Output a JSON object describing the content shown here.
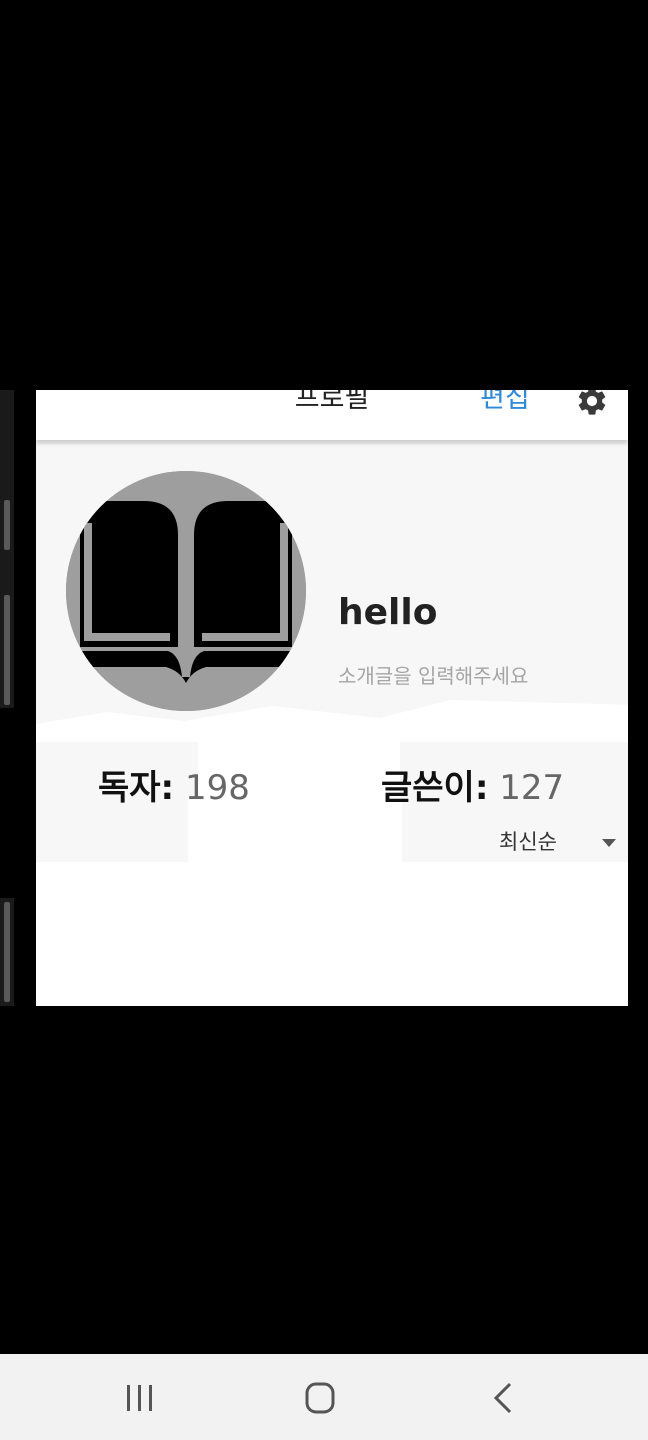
{
  "appbar": {
    "title": "프로필",
    "edit_label": "편집",
    "settings_icon": "gear-icon"
  },
  "profile": {
    "avatar_icon": "open-book-icon",
    "username": "hello",
    "bio_placeholder": "소개글을 입력해주세요"
  },
  "stats": {
    "readers_label": "독자:",
    "readers_value": "198",
    "writers_label": "글쓴이:",
    "writers_value": "127"
  },
  "sort": {
    "selected": "최신순",
    "icon": "caret-down-icon"
  },
  "system_nav": {
    "recents_icon": "recents-icon",
    "home_icon": "home-icon",
    "back_icon": "back-icon"
  },
  "colors": {
    "accent": "#2e8ad8",
    "avatar_bg": "#9e9e9e",
    "background": "#000000"
  }
}
